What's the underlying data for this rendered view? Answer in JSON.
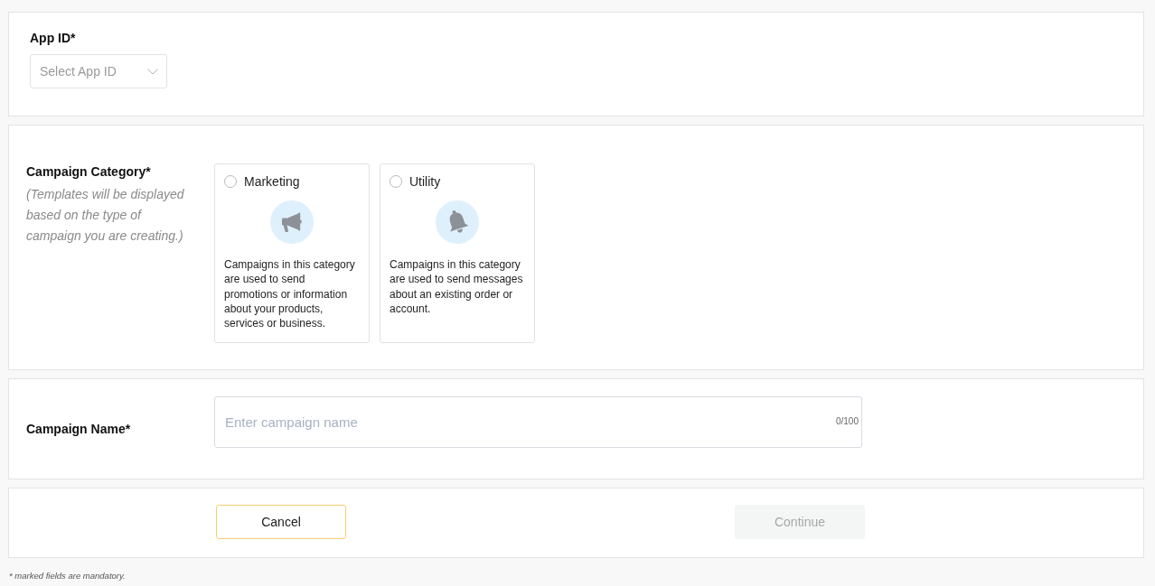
{
  "app_id": {
    "label": "App ID*",
    "placeholder": "Select App ID"
  },
  "campaign_category": {
    "label": "Campaign Category*",
    "hint": "(Templates will be displayed based on the type of campaign you are creating.)",
    "options": [
      {
        "kind": "marketing",
        "label": "Marketing",
        "description": "Campaigns in this category are used to send promotions or information about your products, services or business.",
        "selected": false
      },
      {
        "kind": "utility",
        "label": "Utility",
        "description": "Campaigns in this category are used to send messages about an existing order or account.",
        "selected": false
      }
    ]
  },
  "campaign_name": {
    "label": "Campaign Name*",
    "placeholder": "Enter campaign name",
    "counter": "0/100"
  },
  "actions": {
    "buttons": [
      {
        "kind": "outline",
        "label": "Cancel",
        "disabled": false
      },
      {
        "kind": "filled",
        "label": "Continue",
        "disabled": true
      }
    ]
  },
  "footnote": "* marked fields are mandatory."
}
